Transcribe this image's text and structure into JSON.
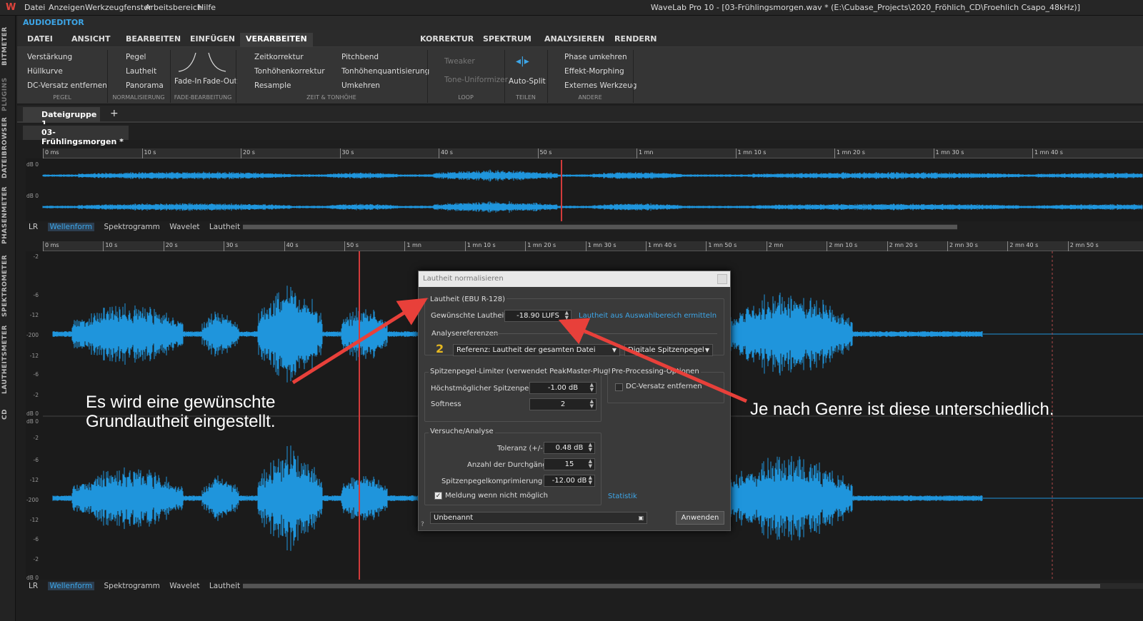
{
  "menubar": {
    "items": [
      "Datei",
      "Anzeigen",
      "Werkzeugfenster",
      "Arbeitsbereich",
      "Hilfe"
    ],
    "window_title": "WaveLab Pro 10 - [03-Frühlingsmorgen.wav * (E:\\Cubase_Projects\\2020_Fröhlich_CD\\Froehlich Csapo_48kHz)]"
  },
  "sidebar": {
    "items": [
      "BITMETER",
      "PLUGINS",
      "DATEIBROWSER",
      "PHASENMETER",
      "SPEKTROMETER",
      "LAUTHEITSMETER",
      "CD"
    ]
  },
  "editor": {
    "title": "AUDIOEDITOR"
  },
  "ribbon_tabs": [
    "DATEI",
    "ANSICHT",
    "BEARBEITEN",
    "EINFÜGEN",
    "VERARBEITEN",
    "KORREKTUR",
    "SPEKTRUM",
    "ANALYSIEREN",
    "RENDERN"
  ],
  "ribbon": {
    "pegel": {
      "items": [
        "Verstärkung",
        "Hüllkurve",
        "DC-Versatz entfernen"
      ],
      "group": "PEGEL"
    },
    "normalisierung": {
      "items": [
        "Pegel",
        "Lautheit",
        "Panorama"
      ],
      "group": "NORMALISIERUNG"
    },
    "fade": {
      "items": [
        "Fade-In",
        "Fade-Out"
      ],
      "group": "FADE-BEARBEITUNG"
    },
    "zeit": {
      "items": [
        "Zeitkorrektur",
        "Tonhöhenkorrektur",
        "Resample",
        "Pitchbend",
        "Tonhöhenquantisierung",
        "Umkehren"
      ],
      "group": "ZEIT & TONHÖHE"
    },
    "loop": {
      "items": [
        "Tweaker",
        "Tone-Uniformizer"
      ],
      "group": "LOOP"
    },
    "teilen": {
      "items": [
        "Auto-Split"
      ],
      "group": "TEILEN"
    },
    "andere": {
      "items": [
        "Phase umkehren",
        "Effekt-Morphing",
        "Externes Werkzeug"
      ],
      "group": "ANDERE"
    }
  },
  "file_tab": {
    "label": "Dateigruppe 1",
    "add": "+"
  },
  "sub_tab": {
    "label": "03-Frühlingsmorgen *"
  },
  "overview_ruler": [
    "0 ms",
    "10 s",
    "20 s",
    "30 s",
    "40 s",
    "50 s",
    "1 mn",
    "1 mn 10 s",
    "1 mn 20 s",
    "1 mn 30 s",
    "1 mn 40 s"
  ],
  "main_ruler": [
    "0 ms",
    "10 s",
    "20 s",
    "30 s",
    "40 s",
    "50 s",
    "1 mn",
    "1 mn 10 s",
    "1 mn 20 s",
    "1 mn 30 s",
    "1 mn 40 s",
    "1 mn 50 s",
    "2 mn",
    "2 mn 10 s",
    "2 mn 20 s",
    "2 mn 30 s",
    "2 mn 40 s",
    "2 mn 50 s"
  ],
  "view_tabs": {
    "lr": "LR",
    "items": [
      "Wellenform",
      "Spektrogramm",
      "Wavelet",
      "Lautheit"
    ]
  },
  "db_labels": {
    "overview": [
      "dB 0",
      "dB 0"
    ],
    "main": [
      "-2",
      "-6",
      "-12",
      "-200",
      "-12",
      "-6",
      "-2",
      "dB 0",
      "dB 0",
      "-2",
      "-6",
      "-12",
      "-200",
      "-12",
      "-6",
      "-2",
      "dB 0"
    ]
  },
  "annotations": {
    "left": [
      "Es wird eine gewünschte",
      "Grundlautheit eingestellt."
    ],
    "right": "Je nach Genre ist diese unterschiedlich."
  },
  "dialog": {
    "title": "Lautheit normalisieren",
    "loudness_group": "Lautheit (EBU R-128)",
    "target_label": "Gewünschte Lautheit",
    "target_value": "-18.90 LUFS",
    "measure_link": "Lautheit aus Auswahlbereich ermitteln",
    "analysis_label": "Analysereferenzen",
    "reference_select": "Referenz: Lautheit der gesamten Datei",
    "peak_select": "Digitale Spitzenpegel",
    "limiter_group": "Spitzenpegel-Limiter (verwendet PeakMaster-PlugIn)",
    "max_peak_label": "Höchstmöglicher Spitzenpegel",
    "max_peak_value": "-1.00 dB",
    "softness_label": "Softness",
    "softness_value": "2",
    "preproc_group": "Pre-Processing-Optionen",
    "dc_label": "DC-Versatz entfernen",
    "attempts_group": "Versuche/Analyse",
    "tolerance_label": "Toleranz (+/-)",
    "tolerance_value": "0.48 dB",
    "passes_label": "Anzahl der Durchgänge",
    "passes_value": "15",
    "compression_label": "Spitzenpegelkomprimierung bis",
    "compression_value": "-12.00 dB",
    "notify_label": "Meldung wenn nicht möglich",
    "stats_link": "Statistik",
    "preset_value": "Unbenannt",
    "apply_label": "Anwenden"
  },
  "colors": {
    "waveform": "#1f95dc",
    "cursor": "#d23b3b",
    "arrow": "#e8403a",
    "link": "#3da6e8"
  }
}
